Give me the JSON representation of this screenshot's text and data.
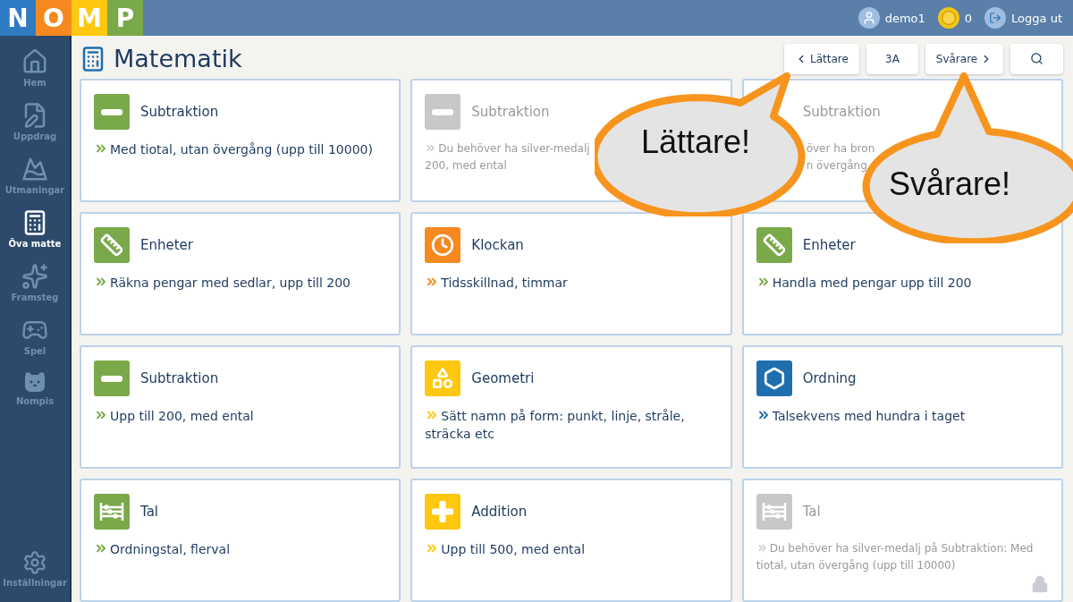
{
  "logo": [
    {
      "letter": "N",
      "color": "#2f7bc4"
    },
    {
      "letter": "O",
      "color": "#f5891f"
    },
    {
      "letter": "M",
      "color": "#fdc80f"
    },
    {
      "letter": "P",
      "color": "#7aa94a"
    }
  ],
  "user": {
    "name": "demo1",
    "coins": "0",
    "logout": "Logga ut"
  },
  "sidebar": {
    "items": [
      {
        "kind": "home",
        "label": "Hem",
        "selected": false
      },
      {
        "kind": "assignment",
        "label": "Uppdrag",
        "selected": false
      },
      {
        "kind": "mountain",
        "label": "Utmaningar",
        "selected": false
      },
      {
        "kind": "calculator",
        "label": "Öva matte",
        "selected": true
      },
      {
        "kind": "progress",
        "label": "Framsteg",
        "selected": false
      },
      {
        "kind": "gamepad",
        "label": "Spel",
        "selected": false
      },
      {
        "kind": "bear",
        "label": "Nompis",
        "selected": false
      }
    ],
    "settings": {
      "label": "Inställningar",
      "selected": false
    }
  },
  "page": {
    "title": "Matematik",
    "easier": "Lättare",
    "level": "3A",
    "harder": "Svårare"
  },
  "cards": [
    {
      "kind": "minus",
      "title": "Subtraktion",
      "color": "#7aa94a",
      "locked": false,
      "lines": [
        "Med tiotal, utan övergång (upp till 10000)"
      ]
    },
    {
      "kind": "minus",
      "title": "Subtraktion",
      "color": "#c8c8c8",
      "locked": true,
      "lines": [
        "Du behöver ha silver-medalj",
        "200, med ental"
      ]
    },
    {
      "title": "Subtraktion",
      "locked": true,
      "covered": true,
      "lines": [
        "över ha bron",
        "n övergång"
      ]
    },
    {
      "kind": "ruler",
      "title": "Enheter",
      "color": "#7aa94a",
      "locked": false,
      "lines": [
        "Räkna pengar med sedlar, upp till 200"
      ]
    },
    {
      "kind": "clock",
      "title": "Klockan",
      "color": "#f5891f",
      "locked": false,
      "lines": [
        "Tidsskillnad, timmar"
      ]
    },
    {
      "kind": "ruler",
      "title": "Enheter",
      "color": "#7aa94a",
      "locked": false,
      "lines": [
        "Handla med pengar upp till 200"
      ]
    },
    {
      "kind": "minus",
      "title": "Subtraktion",
      "color": "#7aa94a",
      "locked": false,
      "lines": [
        "Upp till 200, med ental"
      ]
    },
    {
      "kind": "shapes",
      "title": "Geometri",
      "color": "#fdc80f",
      "locked": false,
      "lines": [
        "Sätt namn på form: punkt, linje, stråle, sträcka etc"
      ]
    },
    {
      "kind": "hexagons",
      "title": "Ordning",
      "color": "#1f6fae",
      "locked": false,
      "lines": [
        "Talsekvens med hundra i taget"
      ]
    },
    {
      "kind": "abacus",
      "title": "Tal",
      "color": "#7aa94a",
      "locked": false,
      "lines": [
        "Ordningstal, flerval"
      ]
    },
    {
      "kind": "plus",
      "title": "Addition",
      "color": "#fdc80f",
      "locked": false,
      "lines": [
        "Upp till 500, med ental"
      ]
    },
    {
      "kind": "abacus",
      "title": "Tal",
      "color": "#c8c8c8",
      "locked": true,
      "lines": [
        "Du behöver ha silver-medalj på Subtraktion: Med tiotal, utan övergång (upp till 10000)"
      ]
    }
  ],
  "callouts": [
    {
      "kind": "left",
      "text": "Lättare!"
    },
    {
      "kind": "right",
      "text": "Svårare!"
    }
  ]
}
